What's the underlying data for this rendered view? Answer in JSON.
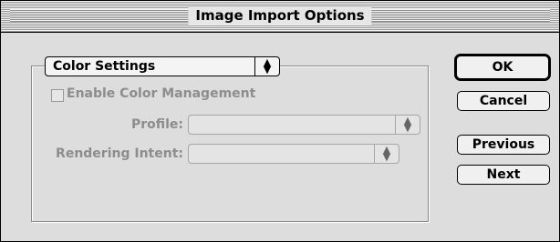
{
  "window": {
    "title": "Image Import Options"
  },
  "color_settings": {
    "popup_label": "Color Settings",
    "enable_label": "Enable Color Management",
    "profile_label": "Profile:",
    "profile_value": "",
    "rendering_intent_label": "Rendering Intent:",
    "rendering_intent_value": ""
  },
  "buttons": {
    "ok": "OK",
    "cancel": "Cancel",
    "previous": "Previous",
    "next": "Next"
  }
}
